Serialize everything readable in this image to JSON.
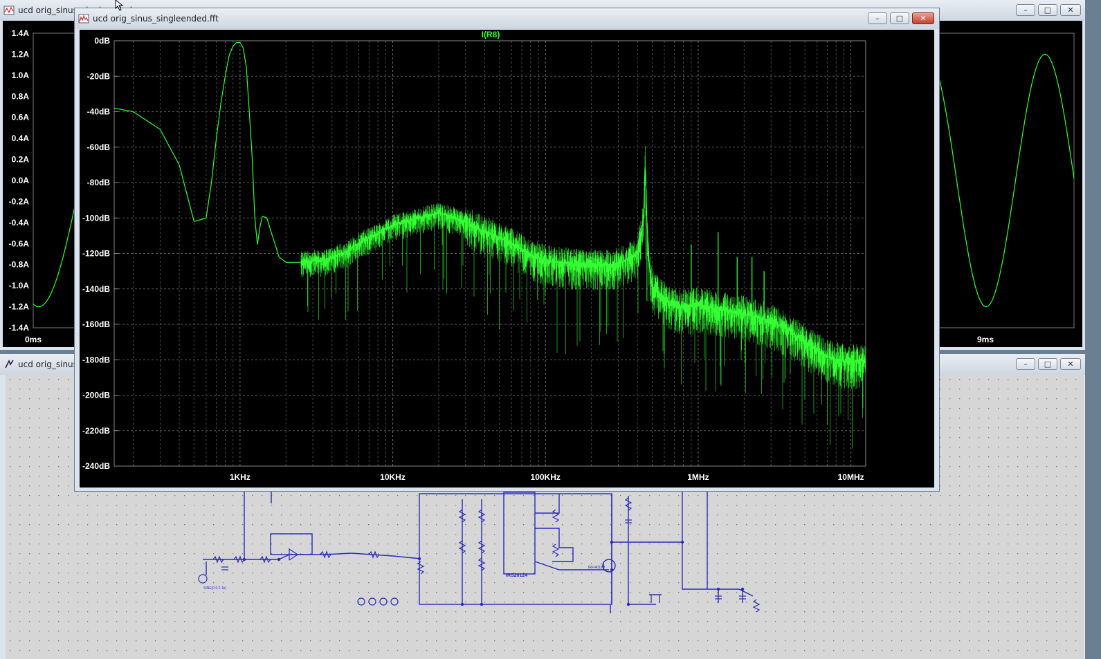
{
  "windows": {
    "waveform": {
      "title": "ucd orig_sinus_singleended.raw",
      "y_ticks": [
        "1.4A",
        "1.2A",
        "1.0A",
        "0.8A",
        "0.6A",
        "0.4A",
        "0.2A",
        "0.0A",
        "-0.2A",
        "-0.4A",
        "-0.6A",
        "-0.8A",
        "-1.0A",
        "-1.2A",
        "-1.4A"
      ],
      "x_left_tick": "0ms",
      "x_right_tick": "9ms"
    },
    "schematic": {
      "title": "ucd orig_sinus_singleended.asc",
      "labels": {
        "ic": "IRS20124",
        "mosfet": "IRFI4019H",
        "source": "SINE(0 0.2 1k)"
      }
    },
    "fft": {
      "title": "ucd orig_sinus_singleended.fft",
      "plot_title": "I(R8)"
    }
  },
  "buttons": {
    "minimize": "–",
    "maximize": "□",
    "close": "✕"
  },
  "colors": {
    "trace": "#33ff33",
    "plot_bg": "#000000",
    "wire": "#2a2ab8",
    "schematic_bg": "#d6d6d6",
    "title_active": "#dbe4ee"
  },
  "chart_data": {
    "type": "line",
    "title": "I(R8)",
    "xscale": "log",
    "x_ticks": [
      "1KHz",
      "10KHz",
      "100KHz",
      "1MHz",
      "10MHz"
    ],
    "y_ticks": [
      "0dB",
      "-20dB",
      "-40dB",
      "-60dB",
      "-80dB",
      "-100dB",
      "-120dB",
      "-140dB",
      "-160dB",
      "-180dB",
      "-200dB",
      "-220dB",
      "-240dB"
    ],
    "xlim": [
      150,
      12500000
    ],
    "ylim": [
      -240,
      0
    ],
    "grid": true,
    "series": [
      {
        "x": [
          150,
          200,
          300,
          400,
          500,
          550,
          600,
          650,
          700,
          750,
          800,
          850,
          900,
          950,
          1000,
          1050,
          1100,
          1150,
          1200,
          1250,
          1300,
          1350,
          1400,
          1500,
          1600,
          1700,
          1800,
          2000,
          2500,
          3000,
          3500,
          4000,
          5000,
          6000,
          8000,
          10000,
          15000,
          20000,
          30000,
          40000,
          50000,
          60000,
          70000,
          80000,
          100000,
          150000,
          200000,
          300000,
          400000,
          440000,
          450000,
          460000,
          480000,
          500000,
          600000,
          700000,
          800000,
          900000,
          1000000,
          1500000,
          2000000,
          3000000,
          4000000,
          5000000,
          6000000,
          7000000,
          8000000,
          10000000,
          12500000
        ],
        "y": [
          -38,
          -40,
          -50,
          -70,
          -102,
          -101,
          -100,
          -80,
          -55,
          -35,
          -20,
          -8,
          -3,
          -1,
          -1,
          -4,
          -15,
          -40,
          -65,
          -100,
          -115,
          -105,
          -99,
          -100,
          -108,
          -115,
          -122,
          -125,
          -125,
          -124,
          -124,
          -122,
          -119,
          -114,
          -109,
          -104,
          -100,
          -97,
          -102,
          -108,
          -111,
          -114,
          -118,
          -121,
          -124,
          -126,
          -127,
          -126,
          -120,
          -100,
          -65,
          -100,
          -128,
          -139,
          -146,
          -150,
          -150,
          -150,
          -149,
          -152,
          -154,
          -158,
          -164,
          -170,
          -175,
          -178,
          -180,
          -181,
          -180
        ]
      }
    ],
    "spurs": [
      {
        "x": 450000,
        "y": -65
      },
      {
        "x": 900000,
        "y": -115
      },
      {
        "x": 1350000,
        "y": -108
      },
      {
        "x": 1800000,
        "y": -122
      },
      {
        "x": 2250000,
        "y": -122
      },
      {
        "x": 2700000,
        "y": -130
      }
    ]
  }
}
